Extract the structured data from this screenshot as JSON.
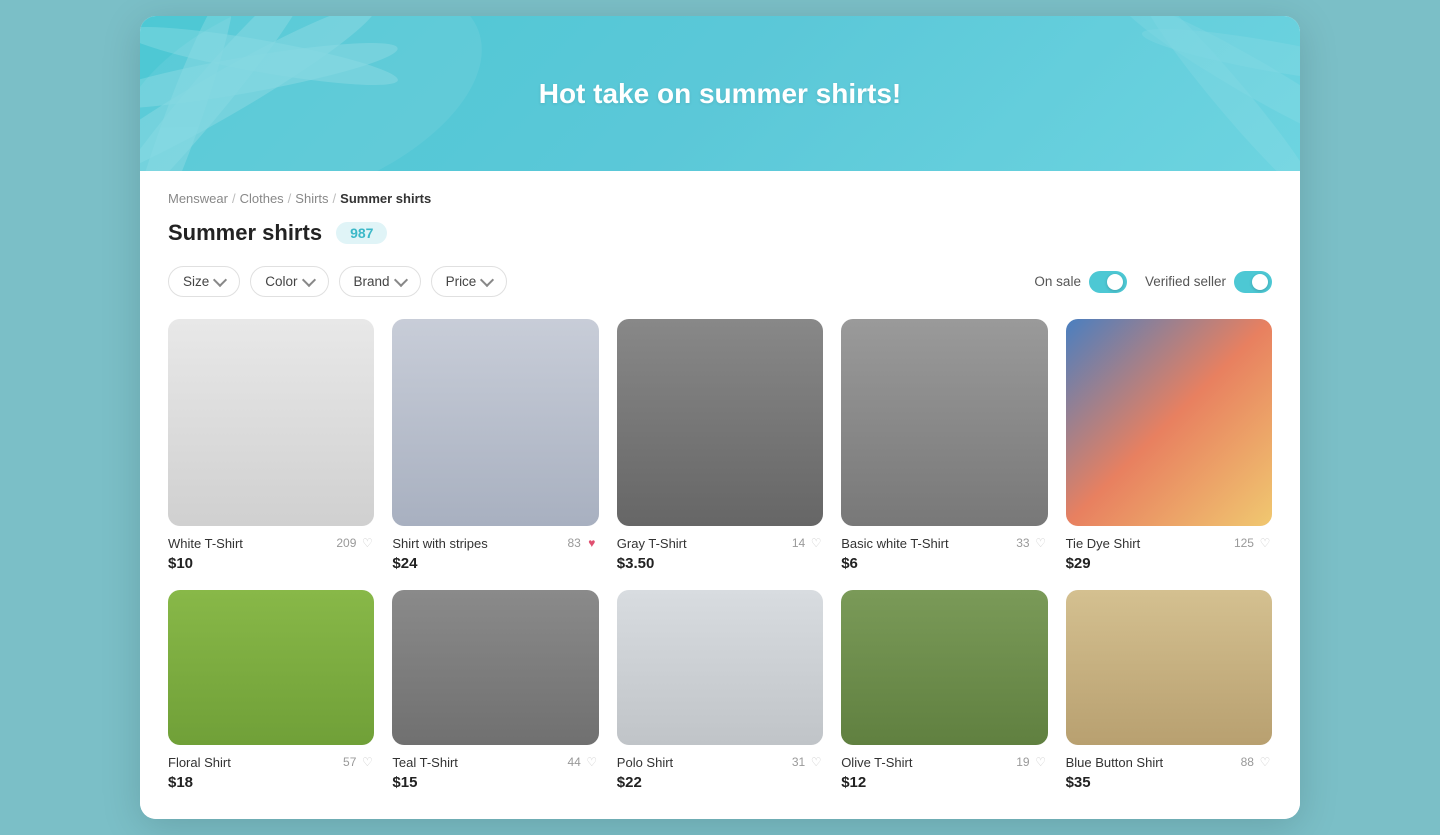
{
  "hero": {
    "title": "Hot take on summer shirts!",
    "bg_color": "#4dc8d4"
  },
  "breadcrumb": {
    "items": [
      "Menswear",
      "Clothes",
      "Shirts"
    ],
    "current": "Summer shirts"
  },
  "page": {
    "title": "Summer shirts",
    "count": "987"
  },
  "filters": {
    "size_label": "Size",
    "color_label": "Color",
    "brand_label": "Brand",
    "price_label": "Price",
    "on_sale_label": "On sale",
    "verified_seller_label": "Verified seller",
    "on_sale_on": true,
    "verified_seller_on": true
  },
  "products": [
    {
      "name": "White T-Shirt",
      "price": "$10",
      "likes": 209,
      "liked": false,
      "img_class": "img-white-tshirt"
    },
    {
      "name": "Shirt with stripes",
      "price": "$24",
      "likes": 83,
      "liked": true,
      "img_class": "img-stripe-shirt"
    },
    {
      "name": "Gray T-Shirt",
      "price": "$3.50",
      "likes": 14,
      "liked": false,
      "img_class": "img-gray-tshirt"
    },
    {
      "name": "Basic white T-Shirt",
      "price": "$6",
      "likes": 33,
      "liked": false,
      "img_class": "img-basic-white"
    },
    {
      "name": "Tie Dye Shirt",
      "price": "$29",
      "likes": 125,
      "liked": false,
      "img_class": "img-tiedye"
    },
    {
      "name": "Floral Shirt",
      "price": "$18",
      "likes": 57,
      "liked": false,
      "img_class": "img-floral"
    },
    {
      "name": "Teal T-Shirt",
      "price": "$15",
      "likes": 44,
      "liked": false,
      "img_class": "img-teal-tshirt"
    },
    {
      "name": "Polo Shirt",
      "price": "$22",
      "likes": 31,
      "liked": false,
      "img_class": "img-polo"
    },
    {
      "name": "Olive T-Shirt",
      "price": "$12",
      "likes": 19,
      "liked": false,
      "img_class": "img-green-tshirt"
    },
    {
      "name": "Blue Button Shirt",
      "price": "$35",
      "likes": 88,
      "liked": false,
      "img_class": "img-blue-shirt"
    }
  ]
}
